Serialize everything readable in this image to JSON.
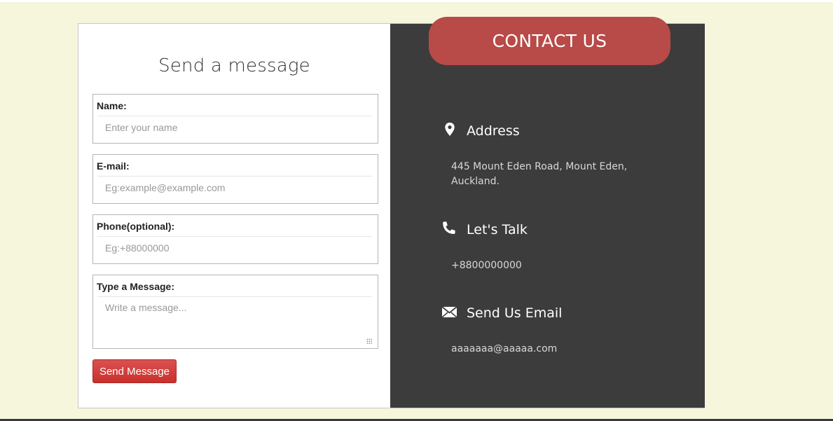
{
  "form": {
    "title": "Send a message",
    "fields": [
      {
        "label": "Name:",
        "placeholder": "Enter your name"
      },
      {
        "label": "E-mail:",
        "placeholder": "Eg:example@example.com"
      },
      {
        "label": "Phone(optional):",
        "placeholder": "Eg:+88000000"
      },
      {
        "label": "Type a Message:",
        "placeholder": "Write a message..."
      }
    ],
    "submit_label": "Send Message"
  },
  "contact": {
    "banner": "CONTACT US",
    "address": {
      "icon": "map-pin-icon",
      "heading": "Address",
      "line1": "445 Mount Eden Road, Mount Eden,",
      "line2": "Auckland."
    },
    "phone": {
      "icon": "phone-icon",
      "heading": "Let's Talk",
      "value": "+8800000000"
    },
    "email": {
      "icon": "envelope-icon",
      "heading": "Send Us Email",
      "value": "aaaaaaa@aaaaa.com"
    }
  },
  "colors": {
    "accent": "#b84a48",
    "button": "#c9302c",
    "panel": "#3c3c3c",
    "background": "#f5f6dc"
  }
}
